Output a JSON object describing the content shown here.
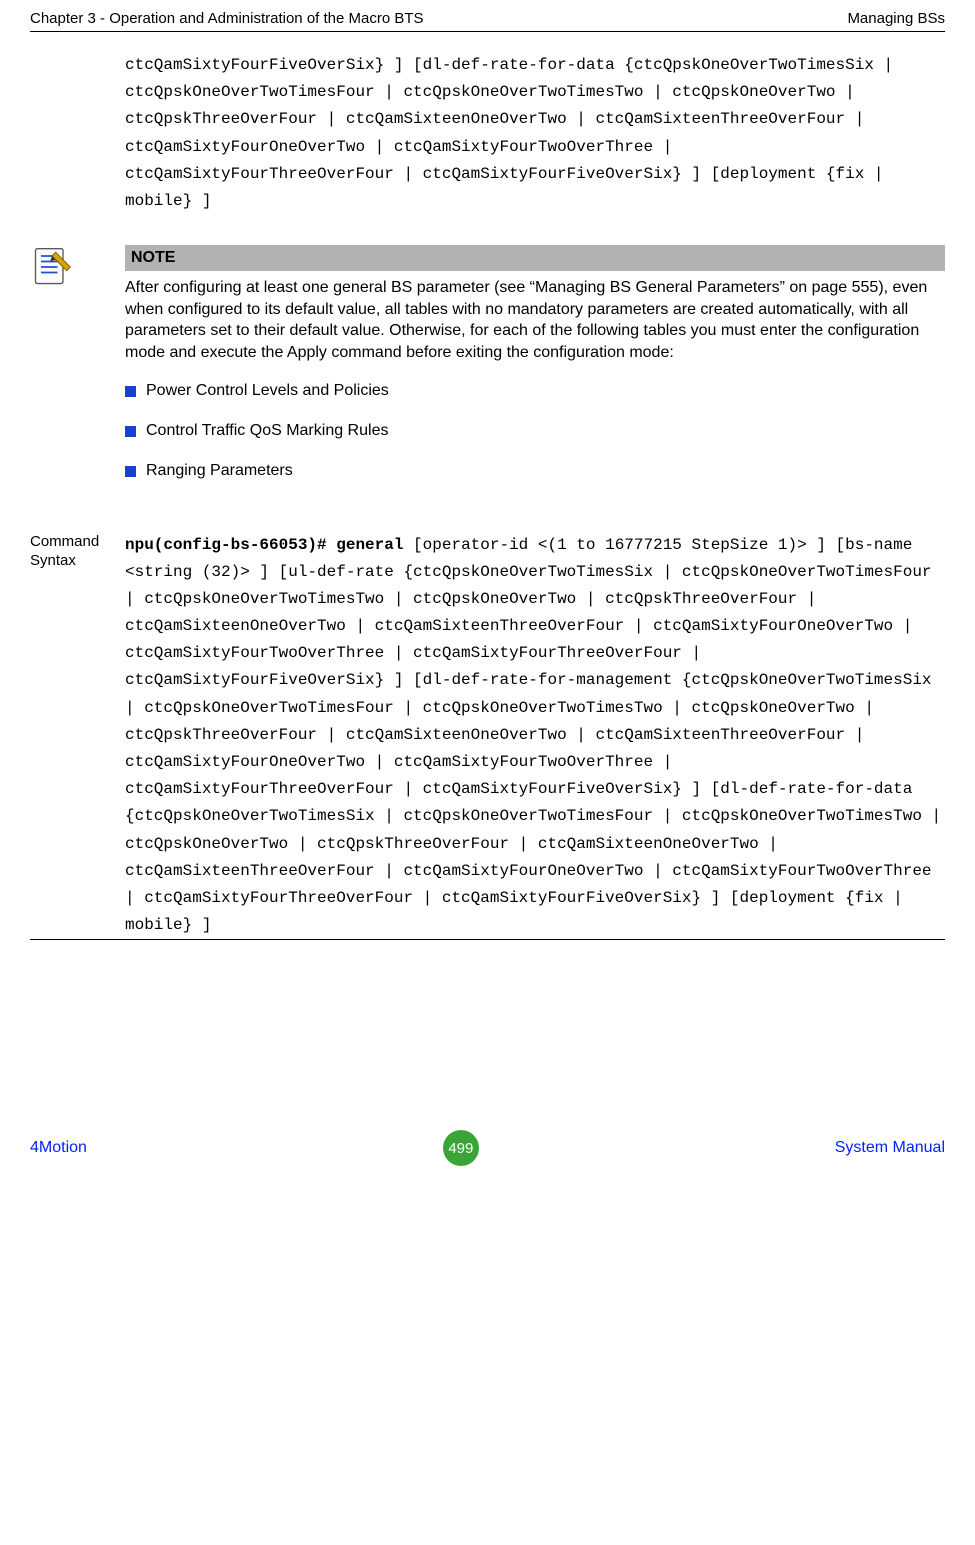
{
  "header": {
    "left": "Chapter 3 - Operation and Administration of the Macro BTS",
    "right": "Managing BSs"
  },
  "top_code": "ctcQamSixtyFourFiveOverSix} ] [dl-def-rate-for-data {ctcQpskOneOverTwoTimesSix | ctcQpskOneOverTwoTimesFour | ctcQpskOneOverTwoTimesTwo | ctcQpskOneOverTwo | ctcQpskThreeOverFour | ctcQamSixteenOneOverTwo | ctcQamSixteenThreeOverFour | ctcQamSixtyFourOneOverTwo | ctcQamSixtyFourTwoOverThree | ctcQamSixtyFourThreeOverFour | ctcQamSixtyFourFiveOverSix} ] [deployment {fix | mobile} ]",
  "note": {
    "title": "NOTE",
    "body": "After configuring at least one general BS parameter (see “Managing BS General Parameters” on page 555), even when configured to its default value, all tables with no mandatory parameters are created automatically, with all parameters set to their default value. Otherwise, for each of the following tables you must enter the configuration mode and execute the Apply command before exiting the configuration mode:",
    "bullets": [
      "Power Control Levels and Policies",
      "Control Traffic QoS Marking Rules",
      "Ranging Parameters"
    ]
  },
  "command_section": {
    "label": "Command Syntax",
    "bold_part": "npu(config-bs-66053)# general",
    "rest": " [operator-id <(1 to 16777215 StepSize 1)> ] [bs-name <string (32)> ] [ul-def-rate {ctcQpskOneOverTwoTimesSix | ctcQpskOneOverTwoTimesFour | ctcQpskOneOverTwoTimesTwo | ctcQpskOneOverTwo | ctcQpskThreeOverFour | ctcQamSixteenOneOverTwo | ctcQamSixteenThreeOverFour | ctcQamSixtyFourOneOverTwo | ctcQamSixtyFourTwoOverThree | ctcQamSixtyFourThreeOverFour | ctcQamSixtyFourFiveOverSix} ] [dl-def-rate-for-management {ctcQpskOneOverTwoTimesSix | ctcQpskOneOverTwoTimesFour | ctcQpskOneOverTwoTimesTwo | ctcQpskOneOverTwo | ctcQpskThreeOverFour | ctcQamSixteenOneOverTwo | ctcQamSixteenThreeOverFour | ctcQamSixtyFourOneOverTwo | ctcQamSixtyFourTwoOverThree | ctcQamSixtyFourThreeOverFour | ctcQamSixtyFourFiveOverSix} ] [dl-def-rate-for-data {ctcQpskOneOverTwoTimesSix | ctcQpskOneOverTwoTimesFour | ctcQpskOneOverTwoTimesTwo | ctcQpskOneOverTwo | ctcQpskThreeOverFour | ctcQamSixteenOneOverTwo | ctcQamSixteenThreeOverFour | ctcQamSixtyFourOneOverTwo | ctcQamSixtyFourTwoOverThree | ctcQamSixtyFourThreeOverFour | ctcQamSixtyFourFiveOverSix} ] [deployment {fix | mobile} ]"
  },
  "footer": {
    "left": "4Motion",
    "page": "499",
    "right": "System Manual"
  }
}
